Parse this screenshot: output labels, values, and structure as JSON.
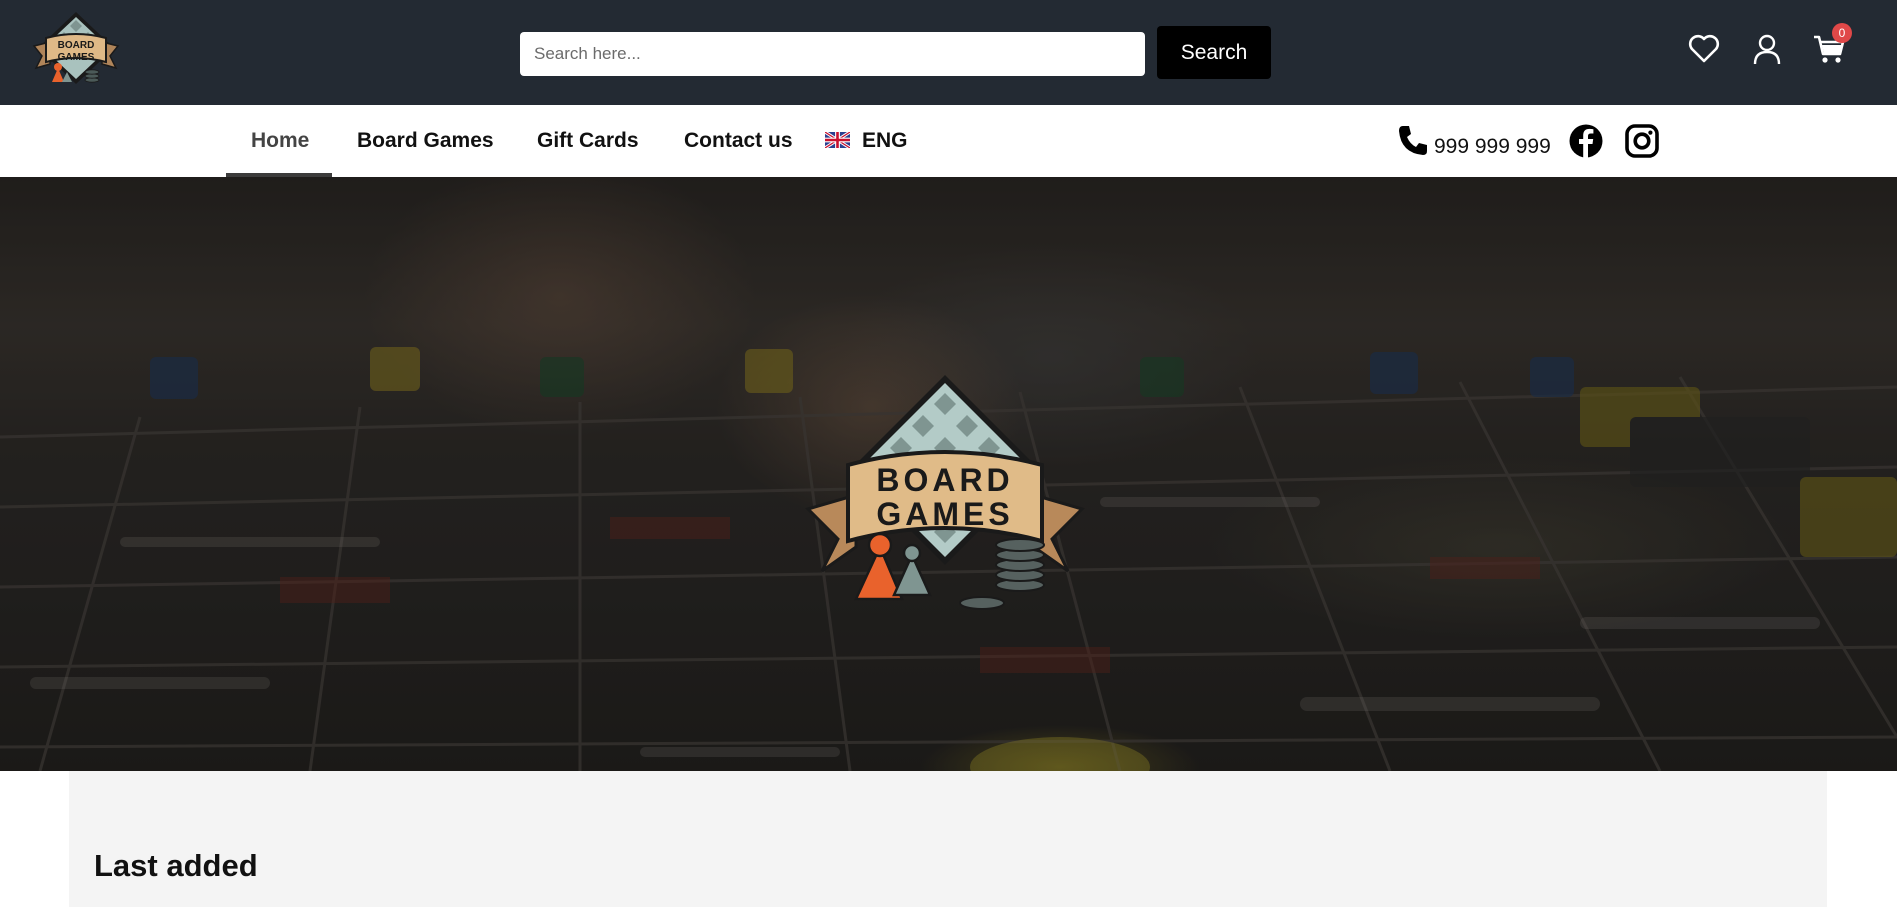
{
  "header": {
    "logo": {
      "text_line1": "BOARD",
      "text_line2": "GAMES",
      "icon": "board-games-logo"
    },
    "search": {
      "placeholder": "Search here...",
      "value": "",
      "button_label": "Search"
    },
    "icons": {
      "wishlist": "heart-icon",
      "account": "user-icon",
      "cart": "cart-icon"
    },
    "cart_count": "0",
    "colors": {
      "background": "#232a33",
      "badge": "#e04848"
    }
  },
  "nav": {
    "items": [
      {
        "label": "Home",
        "active": true
      },
      {
        "label": "Board Games",
        "active": false
      },
      {
        "label": "Gift Cards",
        "active": false
      },
      {
        "label": "Contact us",
        "active": false
      }
    ],
    "language": {
      "label": "ENG",
      "flag": "uk-flag-icon"
    },
    "phone": "999 999 999",
    "social": [
      "facebook-icon",
      "instagram-icon"
    ]
  },
  "hero": {
    "logo": {
      "text_line1": "BOARD",
      "text_line2": "GAMES"
    }
  },
  "sections": {
    "last_added": {
      "title": "Last added"
    }
  }
}
